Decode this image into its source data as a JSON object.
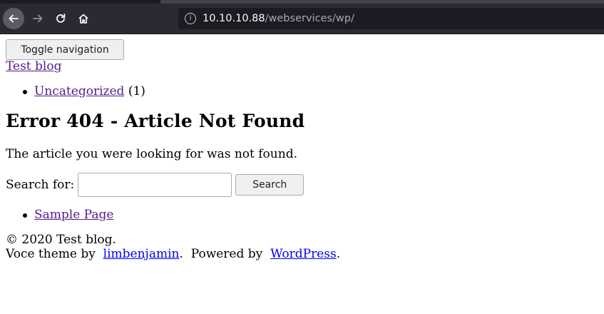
{
  "browser": {
    "url_host": "10.10.10.88",
    "url_path": "/webservices/wp/"
  },
  "page": {
    "toggle_nav_label": "Toggle navigation",
    "brand": "Test blog",
    "categories": [
      {
        "name": "Uncategorized",
        "count": "(1)"
      }
    ],
    "heading": "Error 404 - Article Not Found",
    "message": "The article you were looking for was not found.",
    "search": {
      "label": "Search for:",
      "value": "",
      "button_label": "Search"
    },
    "pages": [
      {
        "name": "Sample Page"
      }
    ],
    "footer": {
      "copyright": "© 2020 Test blog.",
      "theme_prefix": "Voce theme by",
      "theme_author": "limbenjamin",
      "powered_prefix": "Powered by",
      "powered_link": "WordPress",
      "period": "."
    }
  },
  "icons": {
    "back": "arrow-left-icon",
    "forward": "arrow-right-icon",
    "reload": "reload-icon",
    "home": "home-icon",
    "site_info": "info-icon"
  }
}
